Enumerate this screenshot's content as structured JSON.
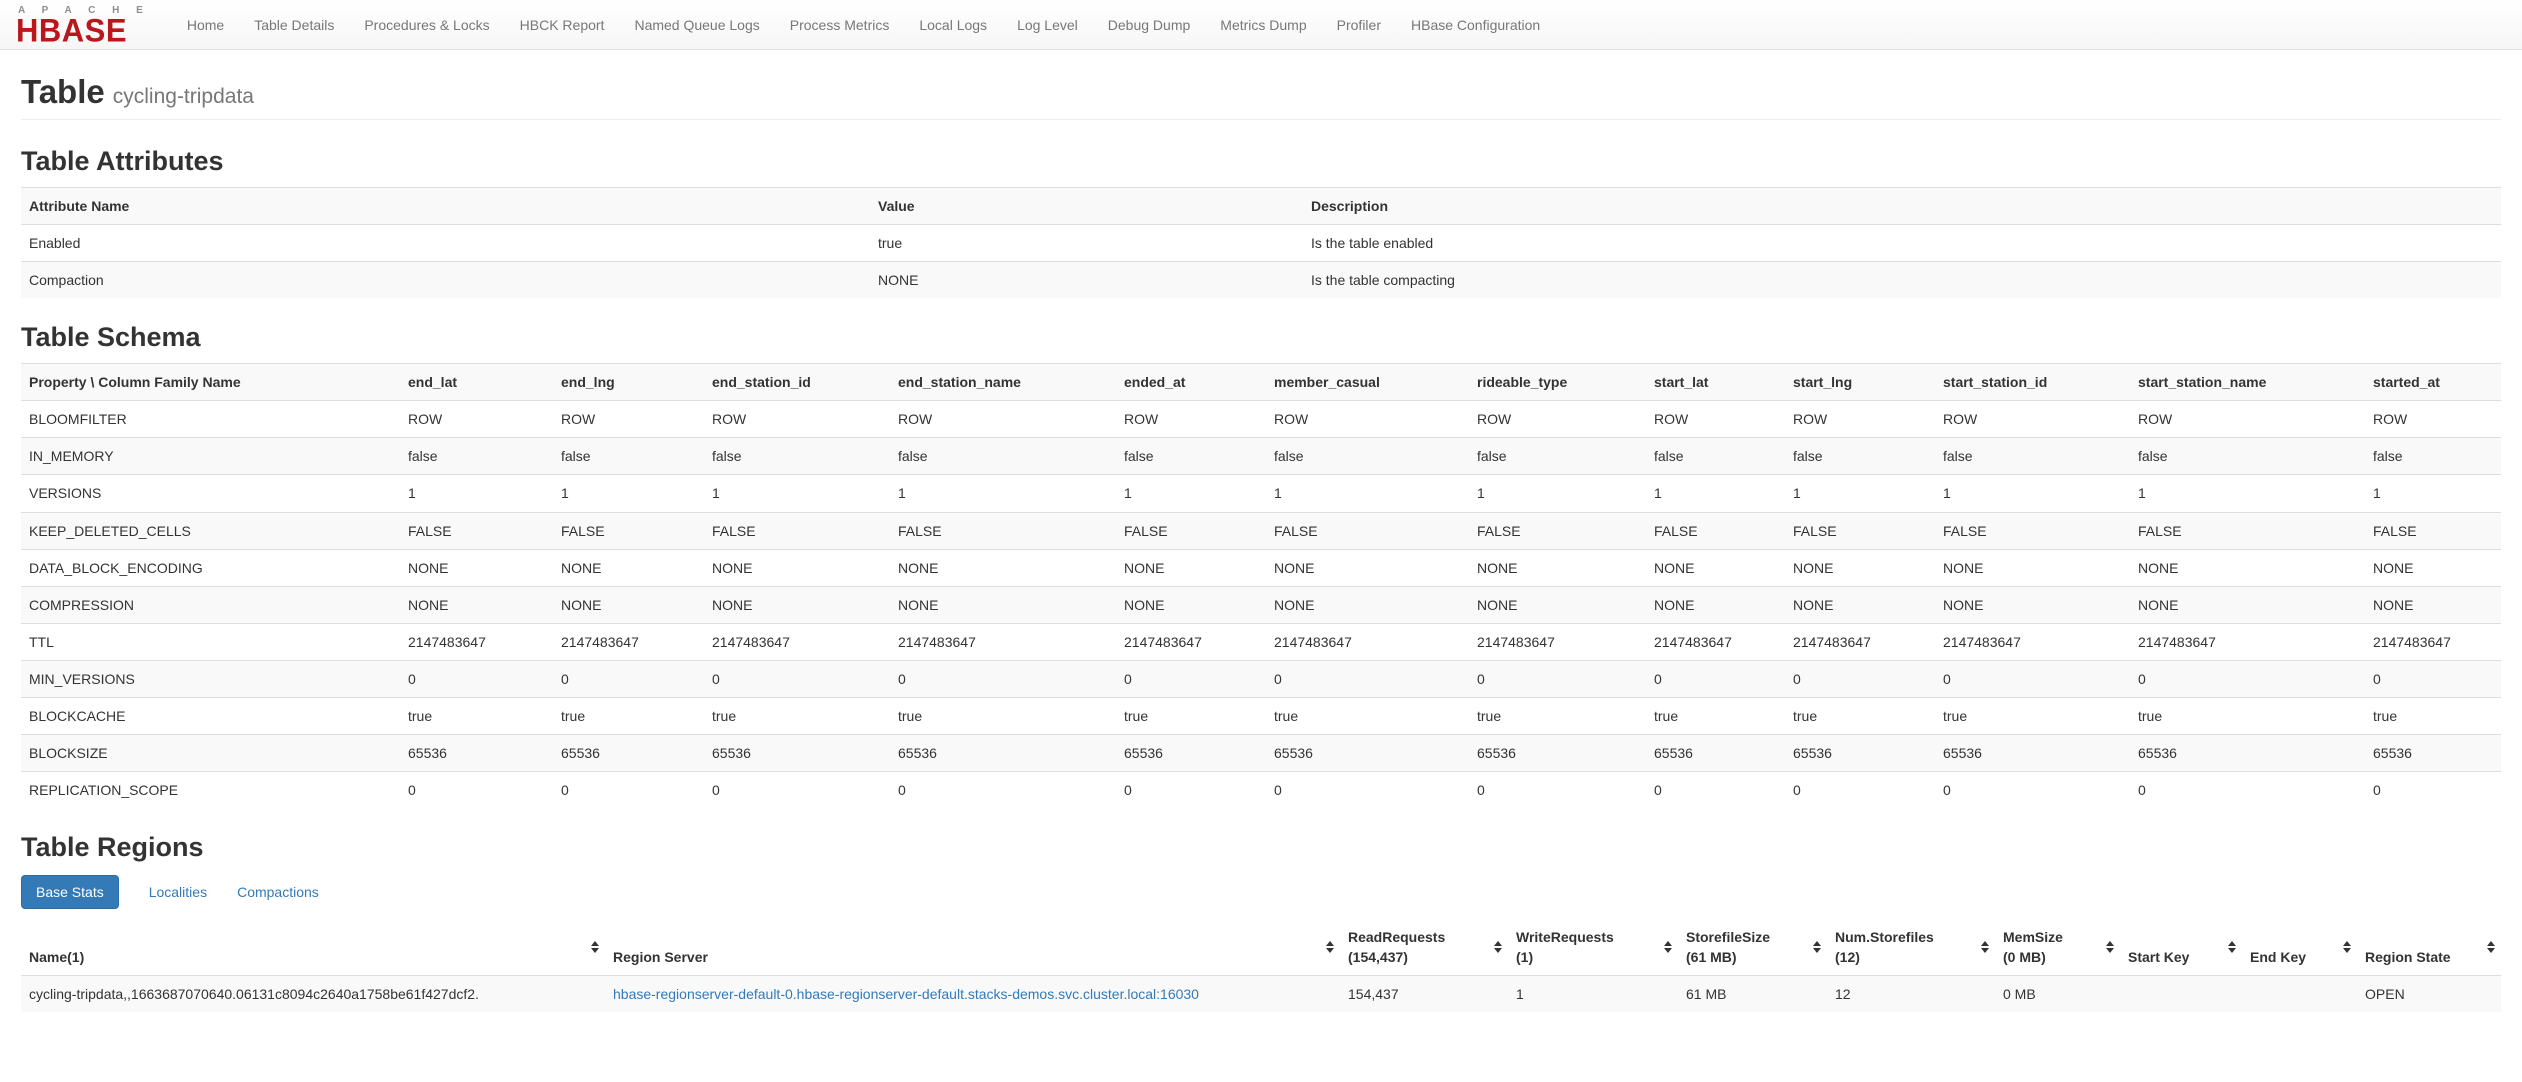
{
  "navbar": {
    "brand": {
      "line1": "A P A C H E",
      "line2": "HBASE"
    },
    "items": [
      "Home",
      "Table Details",
      "Procedures & Locks",
      "HBCK Report",
      "Named Queue Logs",
      "Process Metrics",
      "Local Logs",
      "Log Level",
      "Debug Dump",
      "Metrics Dump",
      "Profiler",
      "HBase Configuration"
    ]
  },
  "page": {
    "title": "Table",
    "subtitle": "cycling-tripdata"
  },
  "attributes": {
    "heading": "Table Attributes",
    "columns": [
      "Attribute Name",
      "Value",
      "Description"
    ],
    "rows": [
      [
        "Enabled",
        "true",
        "Is the table enabled"
      ],
      [
        "Compaction",
        "NONE",
        "Is the table compacting"
      ]
    ]
  },
  "schema": {
    "heading": "Table Schema",
    "corner": "Property \\ Column Family Name",
    "families": [
      "end_lat",
      "end_lng",
      "end_station_id",
      "end_station_name",
      "ended_at",
      "member_casual",
      "rideable_type",
      "start_lat",
      "start_lng",
      "start_station_id",
      "start_station_name",
      "started_at"
    ],
    "properties": [
      {
        "name": "BLOOMFILTER",
        "value": "ROW"
      },
      {
        "name": "IN_MEMORY",
        "value": "false"
      },
      {
        "name": "VERSIONS",
        "value": "1"
      },
      {
        "name": "KEEP_DELETED_CELLS",
        "value": "FALSE"
      },
      {
        "name": "DATA_BLOCK_ENCODING",
        "value": "NONE"
      },
      {
        "name": "COMPRESSION",
        "value": "NONE"
      },
      {
        "name": "TTL",
        "value": "2147483647"
      },
      {
        "name": "MIN_VERSIONS",
        "value": "0"
      },
      {
        "name": "BLOCKCACHE",
        "value": "true"
      },
      {
        "name": "BLOCKSIZE",
        "value": "65536"
      },
      {
        "name": "REPLICATION_SCOPE",
        "value": "0"
      }
    ]
  },
  "regions": {
    "heading": "Table Regions",
    "tabs": [
      {
        "label": "Base Stats",
        "active": true
      },
      {
        "label": "Localities",
        "active": false
      },
      {
        "label": "Compactions",
        "active": false
      }
    ],
    "columns": [
      {
        "label": "Name(1)",
        "sub": ""
      },
      {
        "label": "Region Server",
        "sub": ""
      },
      {
        "label": "ReadRequests",
        "sub": "(154,437)"
      },
      {
        "label": "WriteRequests",
        "sub": "(1)"
      },
      {
        "label": "StorefileSize",
        "sub": "(61 MB)"
      },
      {
        "label": "Num.Storefiles",
        "sub": "(12)"
      },
      {
        "label": "MemSize",
        "sub": "(0 MB)"
      },
      {
        "label": "Start Key",
        "sub": ""
      },
      {
        "label": "End Key",
        "sub": ""
      },
      {
        "label": "Region State",
        "sub": ""
      }
    ],
    "rows": [
      {
        "name": "cycling-tripdata,,1663687070640.06131c8094c2640a1758be61f427dcf2.",
        "region_server": "hbase-regionserver-default-0.hbase-regionserver-default.stacks-demos.svc.cluster.local:16030",
        "read_requests": "154,437",
        "write_requests": "1",
        "storefile_size": "61 MB",
        "num_storefiles": "12",
        "mem_size": "0 MB",
        "start_key": "",
        "end_key": "",
        "region_state": "OPEN"
      }
    ]
  },
  "colors": {
    "accent": "#337ab7",
    "brand_red": "#ba161c",
    "navbar_bg": "#f8f8f8",
    "stripe": "#f9f9f9",
    "border": "#dddddd",
    "text": "#333333",
    "muted": "#777777"
  }
}
